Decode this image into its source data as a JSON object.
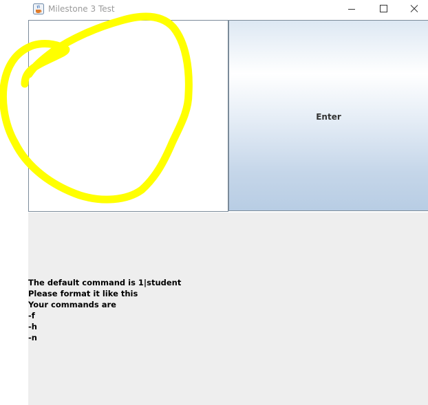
{
  "window": {
    "title": "Milestone 3 Test",
    "app_icon": "java-cup-icon",
    "controls": [
      "minimize-icon",
      "maximize-icon",
      "close-icon"
    ]
  },
  "enter_button": {
    "label": "Enter"
  },
  "output": {
    "lines": [
      "The default command is 1|student",
      "Please format it like this",
      "Your commands are",
      "-f",
      "-h",
      "-n"
    ]
  },
  "colors": {
    "scribble": "#ffff00",
    "output_background": "#eeeeee",
    "panel_border": "#7a8a99"
  }
}
